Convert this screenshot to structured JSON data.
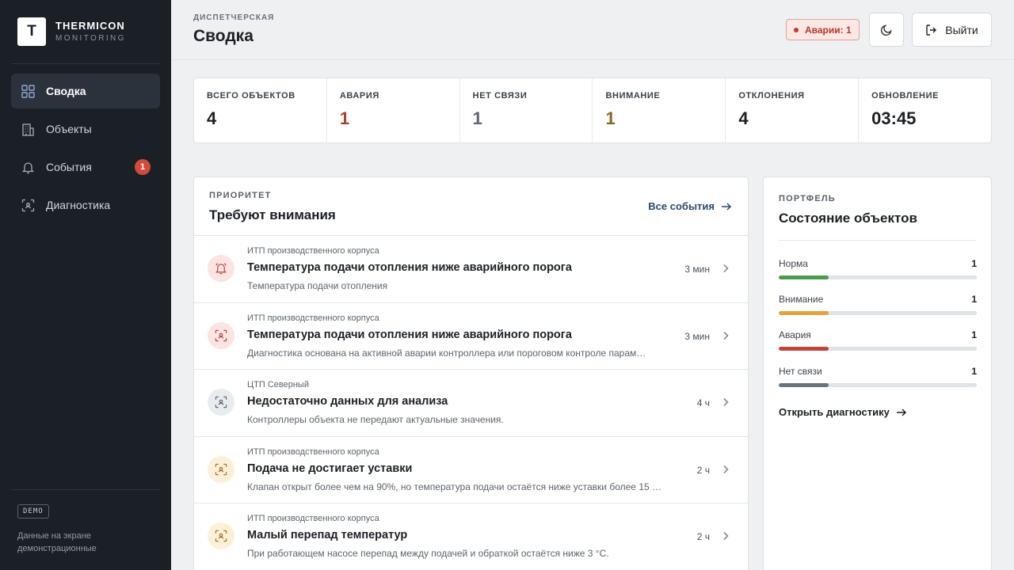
{
  "brand": {
    "logo_letter": "T",
    "name": "THERMICON",
    "subtitle": "MONITORING"
  },
  "sidebar": {
    "items": [
      {
        "label": "Сводка",
        "icon": "dashboard-icon",
        "active": true
      },
      {
        "label": "Объекты",
        "icon": "building-icon",
        "active": false
      },
      {
        "label": "События",
        "icon": "bell-icon",
        "active": false,
        "badge": "1"
      },
      {
        "label": "Диагностика",
        "icon": "scan-icon",
        "active": false
      }
    ],
    "demo_tag": "DEMO",
    "demo_note": "Данные на экране демонстрационные"
  },
  "header": {
    "breadcrumb": "ДИСПЕТЧЕРСКАЯ",
    "title": "Сводка",
    "alarm_pill": "Аварии: 1",
    "theme_icon": "moon-icon",
    "logout_label": "Выйти"
  },
  "stats": [
    {
      "label": "ВСЕГО ОБЪЕКТОВ",
      "value": "4",
      "color": "#1c1f24"
    },
    {
      "label": "АВАРИЯ",
      "value": "1",
      "color": "#a8402f"
    },
    {
      "label": "НЕТ СВЯЗИ",
      "value": "1",
      "color": "#5e6670"
    },
    {
      "label": "ВНИМАНИЕ",
      "value": "1",
      "color": "#8a6420"
    },
    {
      "label": "ОТКЛОНЕНИЯ",
      "value": "4",
      "color": "#1c1f24"
    },
    {
      "label": "ОБНОВЛЕНИЕ",
      "value": "03:45",
      "color": "#1c1f24"
    }
  ],
  "events_panel": {
    "eyebrow": "ПРИОРИТЕТ",
    "title": "Требуют внимания",
    "all_link": "Все события",
    "events": [
      {
        "object": "ИТП производственного корпуса",
        "title": "Температура подачи отопления ниже аварийного порога",
        "desc": "Температура подачи отопления",
        "time": "3 мин",
        "severity": "red",
        "icon": "bell-icon"
      },
      {
        "object": "ИТП производственного корпуса",
        "title": "Температура подачи отопления ниже аварийного порога",
        "desc": "Диагностика основана на активной аварии контроллера или пороговом контроле парам…",
        "time": "3 мин",
        "severity": "red",
        "icon": "scan-icon"
      },
      {
        "object": "ЦТП Северный",
        "title": "Недостаточно данных для анализа",
        "desc": "Контроллеры объекта не передают актуальные значения.",
        "time": "4 ч",
        "severity": "gray",
        "icon": "scan-icon"
      },
      {
        "object": "ИТП производственного корпуса",
        "title": "Подача не достигает уставки",
        "desc": "Клапан открыт более чем на 90%, но температура подачи остаётся ниже уставки более 15 …",
        "time": "2 ч",
        "severity": "amber",
        "icon": "scan-icon"
      },
      {
        "object": "ИТП производственного корпуса",
        "title": "Малый перепад температур",
        "desc": "При работающем насосе перепад между подачей и обраткой остаётся ниже 3 °С.",
        "time": "2 ч",
        "severity": "amber",
        "icon": "scan-icon"
      }
    ]
  },
  "portfolio": {
    "eyebrow": "ПОРТФЕЛЬ",
    "title": "Состояние объектов",
    "rows": [
      {
        "name": "Норма",
        "count": "1",
        "fraction": 0.25,
        "color": "#4f9a4f"
      },
      {
        "name": "Внимание",
        "count": "1",
        "fraction": 0.25,
        "color": "#e0a43a"
      },
      {
        "name": "Авария",
        "count": "1",
        "fraction": 0.25,
        "color": "#c0443a"
      },
      {
        "name": "Нет связи",
        "count": "1",
        "fraction": 0.25,
        "color": "#6a727c"
      }
    ],
    "link": "Открыть диагностику"
  }
}
